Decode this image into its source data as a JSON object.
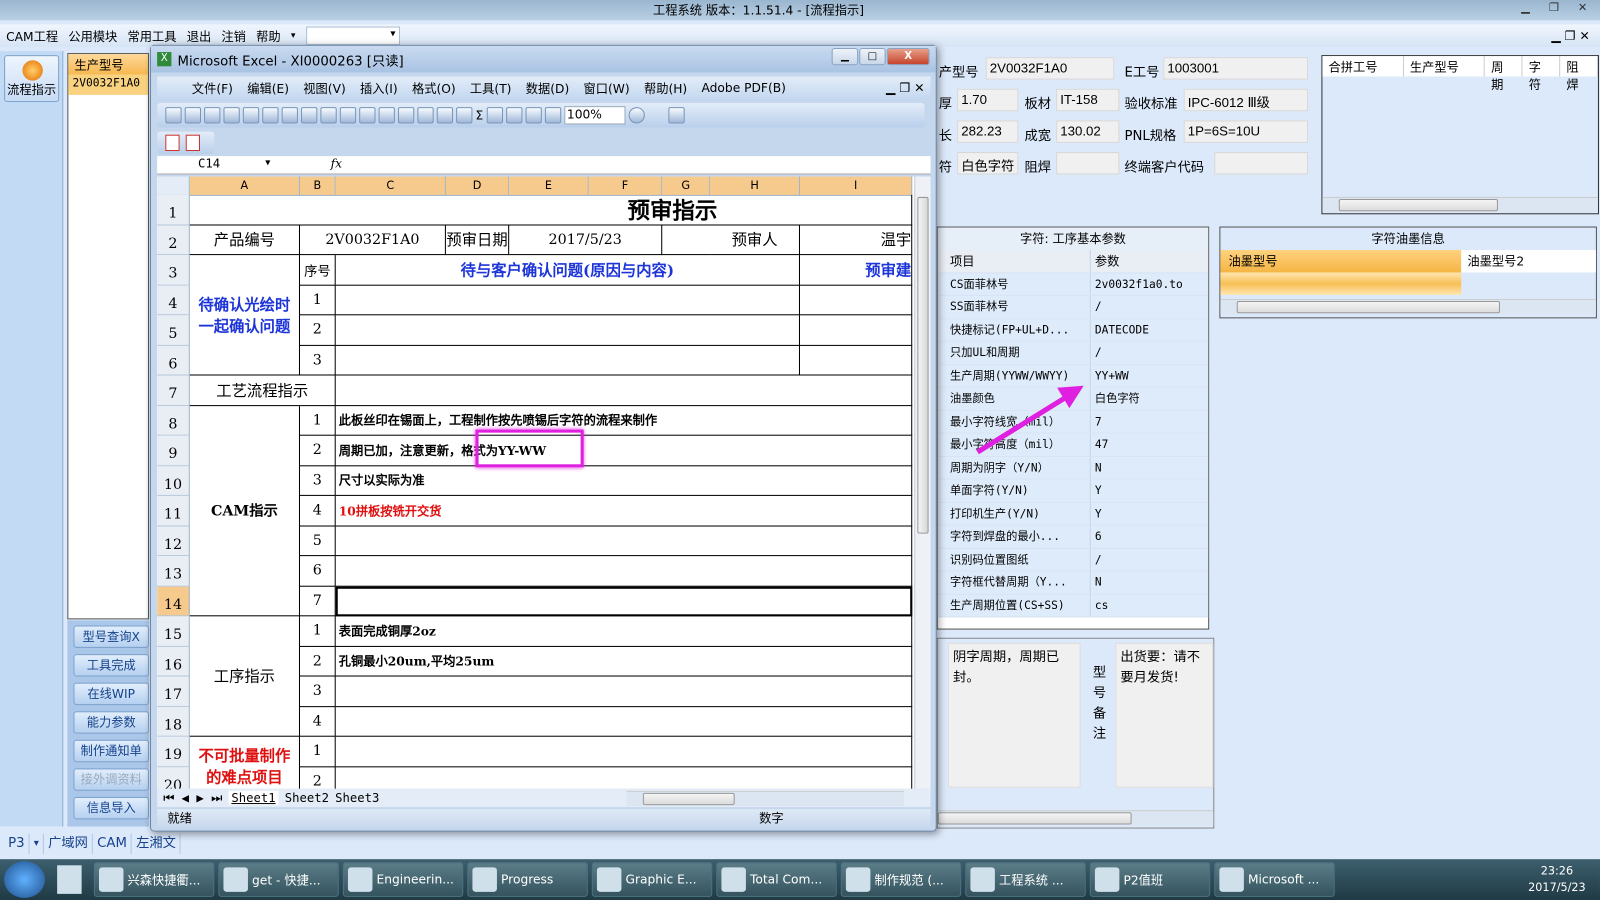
{
  "app": {
    "title": "工程系统   版本：1.1.51.4 - [流程指示]",
    "menu": [
      "CAM工程",
      "公用模块",
      "常用工具",
      "退出",
      "注销",
      "帮助"
    ],
    "flow_button": "流程指示"
  },
  "left_list": {
    "header": "生产型号",
    "rows": [
      "2V0032F1A0"
    ]
  },
  "left_buttons": [
    "型号查询X",
    "工具完成",
    "在线WIP",
    "能力参数",
    "制作通知单",
    "接外调资料",
    "信息导入"
  ],
  "bottom_tabs": [
    "P3",
    "广域网",
    "CAM",
    "左湘文"
  ],
  "info": {
    "prod_model_label": "产型号",
    "prod_model": "2V0032F1A0",
    "e_no_label": "E工号",
    "e_no": "1003001",
    "thick_label": "厚",
    "thick": "1.70",
    "material_label": "板材",
    "material": "IT-158",
    "std_label": "验收标准",
    "std": "IPC-6012 Ⅲ级",
    "len_label": "长",
    "len": "282.23",
    "width_label": "成宽",
    "width": "130.02",
    "pnl_label": "PNL规格",
    "pnl": "1P=6S=10U",
    "char_label": "符",
    "char": "白色字符",
    "mask_label": "阻焊",
    "mask": "",
    "cust_label": "终端客户代码",
    "cust": ""
  },
  "merge_grid": {
    "headers": [
      "合拼工号",
      "生产型号",
      "周期",
      "字符",
      "阻焊"
    ]
  },
  "params": {
    "caption": "字符: 工序基本参数",
    "headers": [
      "项目",
      "参数"
    ],
    "rows": [
      [
        "CS面菲林号",
        "2v0032f1a0.to"
      ],
      [
        "SS面菲林号",
        "/"
      ],
      [
        "快捷标记(FP+UL+D...",
        "DATECODE"
      ],
      [
        "只加UL和周期",
        "/"
      ],
      [
        "生产周期(YYWW/WWYY)",
        "YY+WW"
      ],
      [
        "油墨颜色",
        "白色字符"
      ],
      [
        "最小字符线宽（mil）",
        "7"
      ],
      [
        "最小字符高度（mil）",
        "47"
      ],
      [
        "周期为阴字（Y/N）",
        "N"
      ],
      [
        "单面字符(Y/N)",
        "Y"
      ],
      [
        "打印机生产(Y/N)",
        "Y"
      ],
      [
        "字符到焊盘的最小...",
        "6"
      ],
      [
        "识别码位置图纸",
        "/"
      ],
      [
        "字符框代替周期（Y...",
        "N"
      ],
      [
        "生产周期位置(CS+SS)",
        "cs"
      ]
    ]
  },
  "ink": {
    "caption": "字符油墨信息",
    "headers": [
      "油墨型号",
      "油墨型号2"
    ]
  },
  "remarks": {
    "left": "阴字周期，周期已封。",
    "label": "型号备注",
    "right": "出货要：请不要月发货!"
  },
  "excel": {
    "title": "Microsoft Excel - XI0000263  [只读]",
    "menu": [
      "文件(F)",
      "编辑(E)",
      "视图(V)",
      "插入(I)",
      "格式(O)",
      "工具(T)",
      "数据(D)",
      "窗口(W)",
      "帮助(H)",
      "Adobe PDF(B)"
    ],
    "zoom": "100%",
    "name_box": "C14",
    "fx": "fx",
    "columns": [
      "A",
      "B",
      "C",
      "D",
      "E",
      "F",
      "G",
      "H",
      "I"
    ],
    "rows": [
      "1",
      "2",
      "3",
      "4",
      "5",
      "6",
      "7",
      "8",
      "9",
      "10",
      "11",
      "12",
      "13",
      "14",
      "15",
      "16",
      "17",
      "18",
      "19",
      "20"
    ],
    "sheets": [
      "Sheet1",
      "Sheet2",
      "Sheet3"
    ],
    "status": "就绪",
    "status_mode": "数字",
    "cells": {
      "title": "预审指示",
      "prod_no_label": "产品编号",
      "prod_no": "2V0032F1A0",
      "date_label": "预审日期",
      "date": "2017/5/23",
      "reviewer_label": "预审人",
      "reviewer": "温宇",
      "confirm_label": "待确认光绘时一起确认问题",
      "seq_label": "序号",
      "question_header": "待与客户确认问题(原因与内容)",
      "suggest_header": "预审建",
      "flow_label": "工艺流程指示",
      "cam_label": "CAM指示",
      "proc_label": "工序指示",
      "hard_label": "不可批量制作的难点项目",
      "cam_items": [
        "此板丝印在锡面上，工程制作按先喷锡后字符的流程来制作",
        "周期已加，注意更新，格式为YY-WW",
        "尺寸以实际为准",
        "10拼板按铣开交货",
        "",
        "",
        ""
      ],
      "proc_items": [
        "表面完成铜厚2oz",
        "孔铜最小20um,平均25um",
        "",
        ""
      ]
    }
  },
  "taskbar": {
    "items": [
      "兴森快捷衢...",
      "get - 快捷...",
      "Engineerin...",
      "Progress",
      "Graphic E...",
      "Total Com...",
      "制作规范 (...",
      "工程系统 ...",
      "P2值班",
      "Microsoft ..."
    ],
    "time": "23:26",
    "date": "2017/5/23"
  },
  "colors": {
    "highlight": "#e020e0",
    "blue_text": "#1d35d8",
    "red_text": "#e01010"
  }
}
